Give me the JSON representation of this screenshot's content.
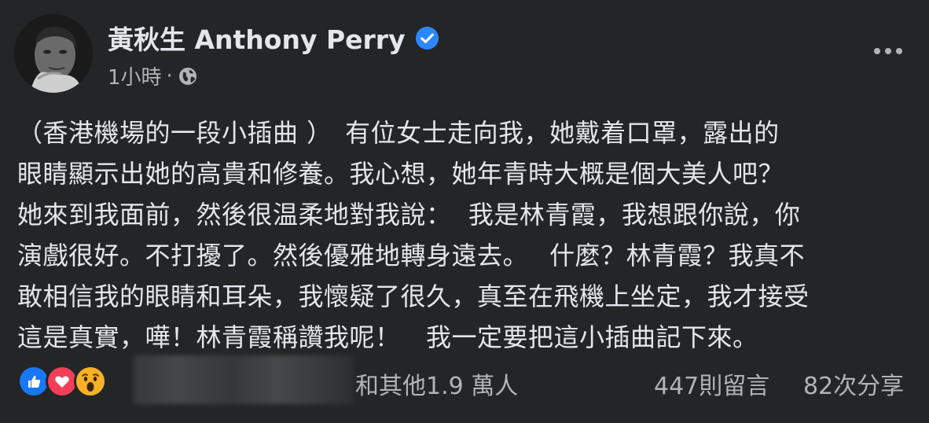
{
  "header": {
    "author_name": "黃秋生 Anthony Perry",
    "timestamp": "1小時",
    "separator": "·",
    "privacy_icon": "globe-icon",
    "verified_icon": "verified-badge-icon",
    "more_icon": "more-dots-icon"
  },
  "post": {
    "lines": [
      "（香港機場的一段小插曲 ）　有位女士走向我，她戴着口罩，露出的",
      "眼睛顯示出她的高貴和修養。我心想，她年青時大概是個大美人吧？",
      "她來到我面前，然後很温柔地對我說：  我是林青霞，我想跟你說，你",
      "演戲很好。不打擾了。然後優雅地轉身遠去。　 什麼？林青霞？我真不",
      "敢相信我的眼睛和耳朵，我懷疑了很久，真至在飛機上坐定，我才接受",
      "這是真實，嘩！林青霞稱讚我呢！　我一定要把這小插曲記下來。"
    ]
  },
  "footer": {
    "reactions": [
      "like-icon",
      "love-icon",
      "wow-icon"
    ],
    "others_text": "和其他1.9 萬人",
    "comments_text": "447則留言",
    "shares_text": "82次分享"
  },
  "colors": {
    "background": "#242526",
    "text_primary": "#e4e6eb",
    "text_secondary": "#b0b3b8",
    "verified_blue": "#2d88ff",
    "like_blue": "#1877f2",
    "love_red": "#f33e58",
    "wow_yellow": "#f7b125"
  }
}
